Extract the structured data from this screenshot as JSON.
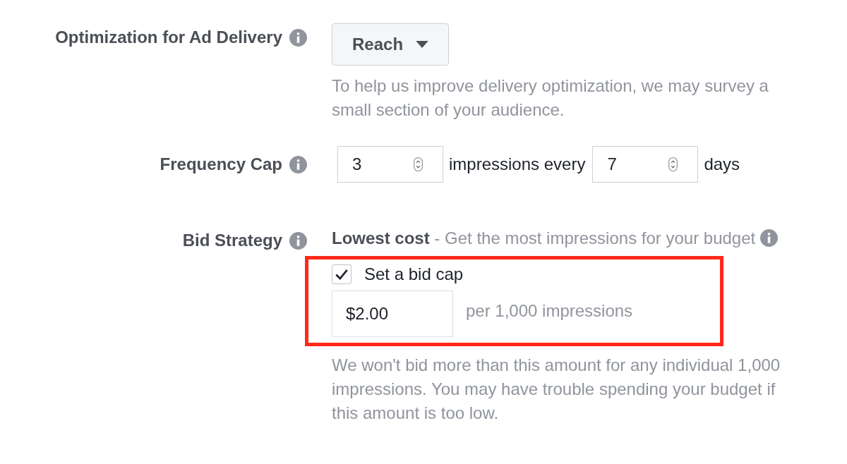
{
  "optimization": {
    "label": "Optimization for Ad Delivery",
    "dropdown": "Reach",
    "help": "To help us improve delivery optimization, we may survey a small section of your audience."
  },
  "frequency_cap": {
    "label": "Frequency Cap",
    "impressions": "3",
    "middle_text": "impressions every",
    "days": "7",
    "unit": "days"
  },
  "bid_strategy": {
    "label": "Bid Strategy",
    "strategy_name": "Lowest cost",
    "strategy_desc": "- Get the most impressions for your budget",
    "bid_cap": {
      "label": "Set a bid cap",
      "checked": true,
      "value": "$2.00",
      "unit": "per 1,000 impressions"
    },
    "help": "We won't bid more than this amount for any individual 1,000 impressions. You may have trouble spending your budget if this amount is too low."
  }
}
